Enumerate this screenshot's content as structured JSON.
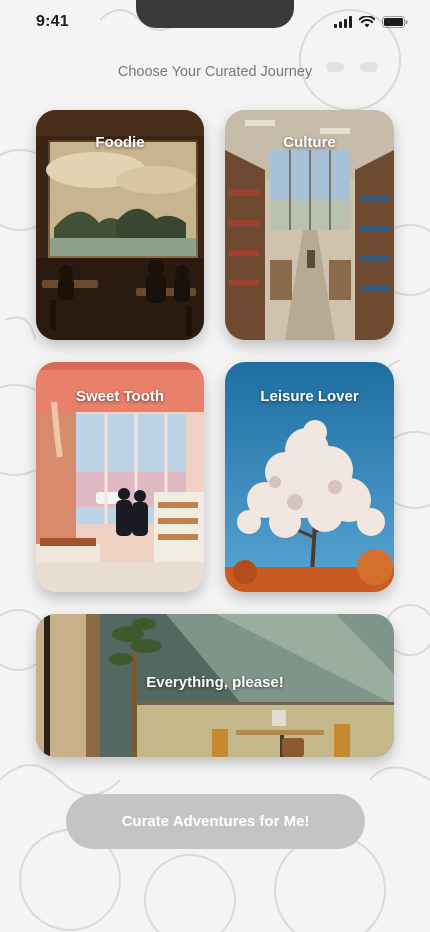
{
  "status_bar": {
    "time": "9:41"
  },
  "title": "Choose Your Curated Journey",
  "journeys": [
    {
      "label": "Foodie"
    },
    {
      "label": "Culture"
    },
    {
      "label": "Sweet Tooth"
    },
    {
      "label": "Leisure Lover"
    },
    {
      "label": "Everything, please!"
    }
  ],
  "cta": {
    "label": "Curate Adventures for Me!",
    "enabled": false
  },
  "colors": {
    "background": "#f4f4f4",
    "cta_disabled": "#c4c4c4",
    "title": "#777777"
  }
}
